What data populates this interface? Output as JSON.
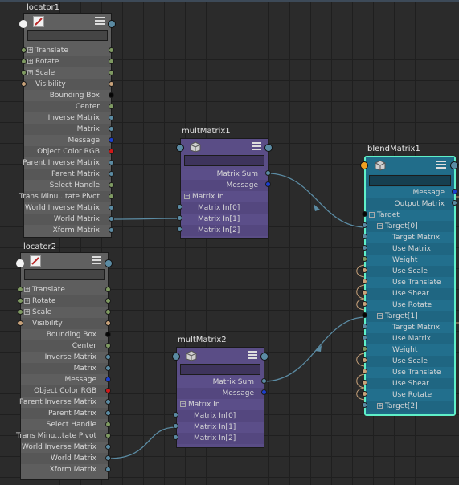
{
  "colors": {
    "background": "#2b2b2b",
    "locator_node": "#5e5e5e",
    "mult_node": "#5a4d86",
    "blend_node": "#216d8a",
    "selected_outline": "#5ff0c8",
    "message_plug": "#1b3fd0",
    "color_plug": "#d01818",
    "vector_plug": "#7f9a62",
    "matrix_plug": "#5b8ba3",
    "bool_plug": "#c8a27a",
    "black_plug": "#050505"
  },
  "locator1": {
    "title": "locator1",
    "rows": [
      "Translate",
      "Rotate",
      "Scale",
      "Visibility",
      "Bounding Box",
      "Center",
      "Inverse Matrix",
      "Matrix",
      "Message",
      "Object Color RGB",
      "Parent Inverse Matrix",
      "Parent Matrix",
      "Select Handle",
      "Trans Minu...tate Pivot",
      "World Inverse Matrix",
      "World Matrix",
      "Xform Matrix"
    ]
  },
  "locator2": {
    "title": "locator2",
    "rows": [
      "Translate",
      "Rotate",
      "Scale",
      "Visibility",
      "Bounding Box",
      "Center",
      "Inverse Matrix",
      "Matrix",
      "Message",
      "Object Color RGB",
      "Parent Inverse Matrix",
      "Parent Matrix",
      "Select Handle",
      "Trans Minu...tate Pivot",
      "World Inverse Matrix",
      "World Matrix",
      "Xform Matrix"
    ]
  },
  "multMatrix1": {
    "title": "multMatrix1",
    "matrix_sum": "Matrix Sum",
    "message": "Message",
    "matrix_in": "Matrix In",
    "inputs": [
      "Matrix In[0]",
      "Matrix In[1]",
      "Matrix In[2]"
    ]
  },
  "multMatrix2": {
    "title": "multMatrix2",
    "matrix_sum": "Matrix Sum",
    "message": "Message",
    "matrix_in": "Matrix In",
    "inputs": [
      "Matrix In[0]",
      "Matrix In[1]",
      "Matrix In[2]"
    ]
  },
  "blendMatrix1": {
    "title": "blendMatrix1",
    "message": "Message",
    "output_matrix": "Output Matrix",
    "target": "Target",
    "target0": "Target[0]",
    "target1": "Target[1]",
    "target2": "Target[2]",
    "target_attrs": [
      "Target Matrix",
      "Use Matrix",
      "Weight",
      "Use Scale",
      "Use Translate",
      "Use Shear",
      "Use Rotate"
    ]
  }
}
